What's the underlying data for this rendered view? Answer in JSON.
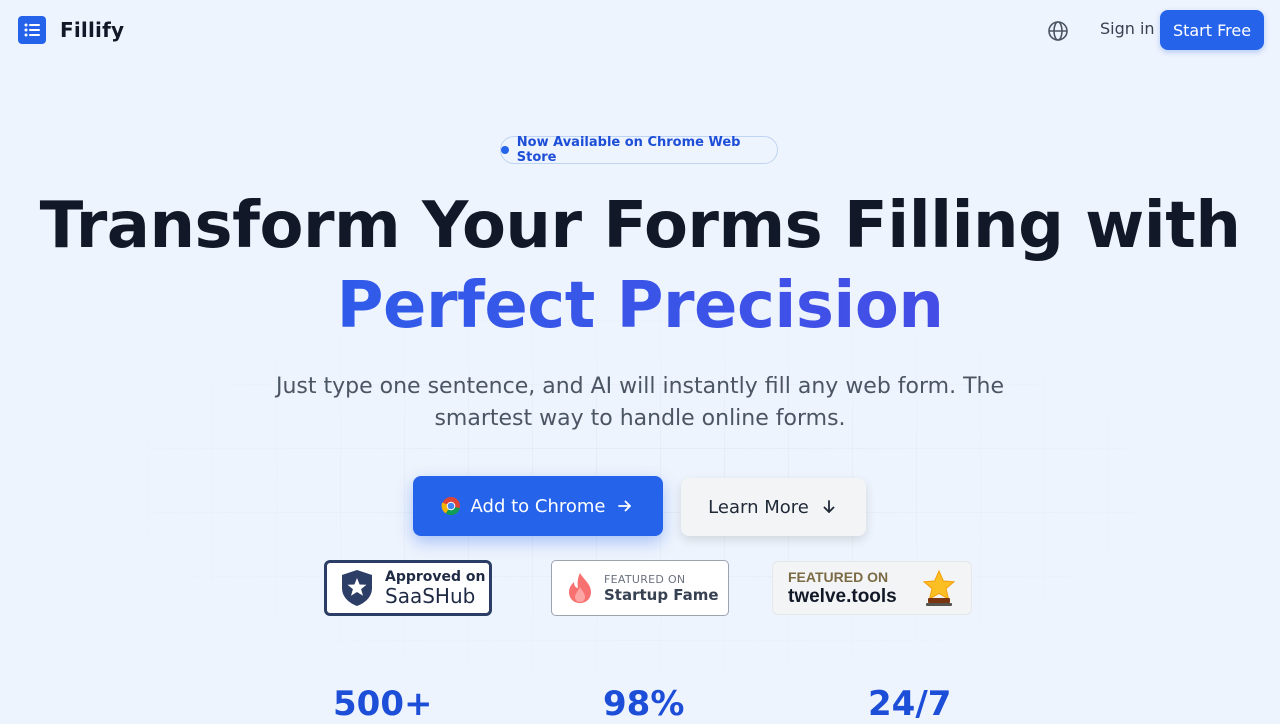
{
  "header": {
    "brand": "Fillify",
    "sign_in": "Sign in",
    "start_free": "Start Free"
  },
  "hero": {
    "pill": "Now Available on Chrome Web Store",
    "title_line1": "Transform Your Forms Filling with",
    "title_line2": "Perfect Precision",
    "subtitle": "Just type one sentence, and AI will instantly fill any web form. The smartest way to handle online forms.",
    "primary_button": "Add to Chrome",
    "secondary_button": "Learn More"
  },
  "badges": {
    "saashub": {
      "top": "Approved on",
      "bottom": "SaaSHub"
    },
    "startup_fame": {
      "top": "FEATURED ON",
      "bottom": "Startup Fame"
    },
    "twelve_tools": {
      "top": "FEATURED ON",
      "bottom": "twelve.tools"
    }
  },
  "stats": [
    "500+",
    "98%",
    "24/7"
  ],
  "colors": {
    "accent": "#2563eb",
    "title_gradient_start": "#2563eb",
    "title_gradient_end": "#4f46e5",
    "background": "#eef4fd"
  },
  "icons": {
    "logo": "list-document-icon",
    "language": "globe-icon",
    "chrome": "chrome-icon",
    "arrow_right": "arrow-right-icon",
    "arrow_down": "arrow-down-icon",
    "saashub": "shield-star-icon",
    "startup_fame": "flame-icon",
    "twelve_tools": "trophy-star-icon"
  }
}
